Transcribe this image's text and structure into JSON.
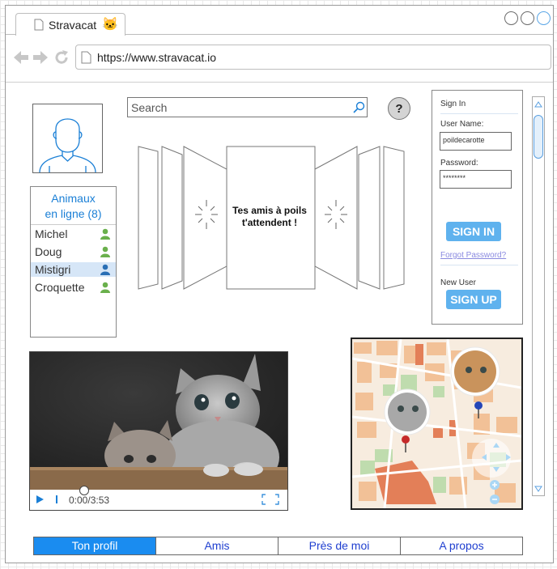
{
  "browser": {
    "tab_title": "Stravacat",
    "tab_emoji": "🐱",
    "url": "https://www.stravacat.io"
  },
  "search": {
    "placeholder": "Search"
  },
  "help": {
    "label": "?"
  },
  "carousel": {
    "caption_line1": "Tes amis à poils",
    "caption_line2": "t'attendent !"
  },
  "online": {
    "title_line1": "Animaux",
    "title_line2": "en ligne (8)",
    "buddies": [
      {
        "name": "Michel",
        "selected": false
      },
      {
        "name": "Doug",
        "selected": false
      },
      {
        "name": "Mistigri",
        "selected": true
      },
      {
        "name": "Croquette",
        "selected": false
      }
    ]
  },
  "signin": {
    "title": "Sign In",
    "username_label": "User Name:",
    "username_value": "poildecarotte",
    "password_label": "Password:",
    "password_value": "********",
    "signin_button": "SIGN IN",
    "forgot_link": "Forgot Password?",
    "new_user_label": "New User",
    "signup_button": "SIGN UP"
  },
  "video": {
    "time": "0:00/3:53",
    "progress": 0
  },
  "bottom_tabs": [
    "Ton profil",
    "Amis",
    "Près de moi",
    "A propos"
  ],
  "colors": {
    "accent": "#1a8cf0",
    "button": "#5fb2ee",
    "online_green": "#6ab04c",
    "selected_blue": "#2a6fb5"
  }
}
